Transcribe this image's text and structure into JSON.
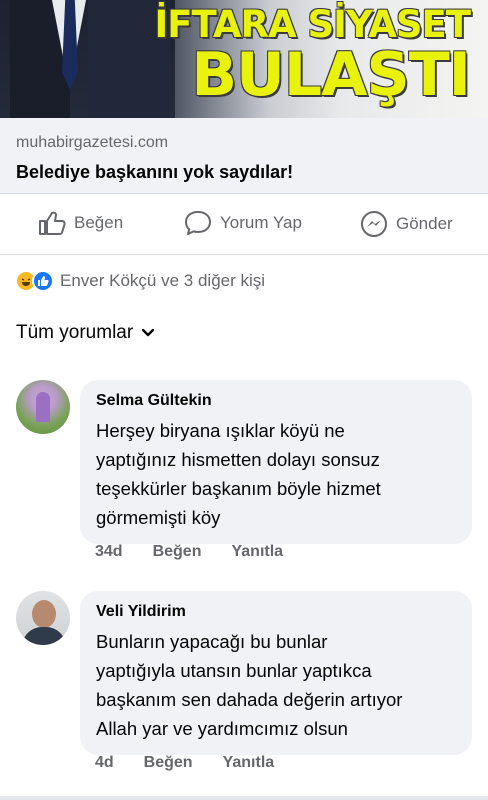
{
  "banner": {
    "headline_line1": "İFTARA SİYASET",
    "headline_line2": "BULAŞTI"
  },
  "link": {
    "domain": "muhabirgazetesi.com",
    "title": "Belediye başkanını yok saydılar!"
  },
  "actions": {
    "like": "Beğen",
    "comment": "Yorum Yap",
    "send": "Gönder"
  },
  "reactions": {
    "icons": [
      "haha-icon",
      "like-icon"
    ],
    "text": "Enver Kökçü ve 3 diğer kişi"
  },
  "filter": {
    "label": "Tüm yorumlar"
  },
  "comments": [
    {
      "name": "Selma Gültekin",
      "lines": [
        "Herşey biryana ışıklar köyü ne",
        "yaptığınız hismetten dolayı sonsuz",
        "teşekkürler başkanım böyle hizmet",
        "görmemişti köy"
      ],
      "time": "34d",
      "like": "Beğen",
      "reply": "Yanıtla"
    },
    {
      "name": "Veli Yildirim",
      "lines": [
        "Bunların yapacağı bu bunlar",
        "yaptığıyla utansın bunlar yaptıkca",
        "başkanım sen dahada değerin artıyor",
        "Allah yar ve yardımcımız olsun"
      ],
      "time": "4d",
      "like": "Beğen",
      "reply": "Yanıtla"
    }
  ]
}
